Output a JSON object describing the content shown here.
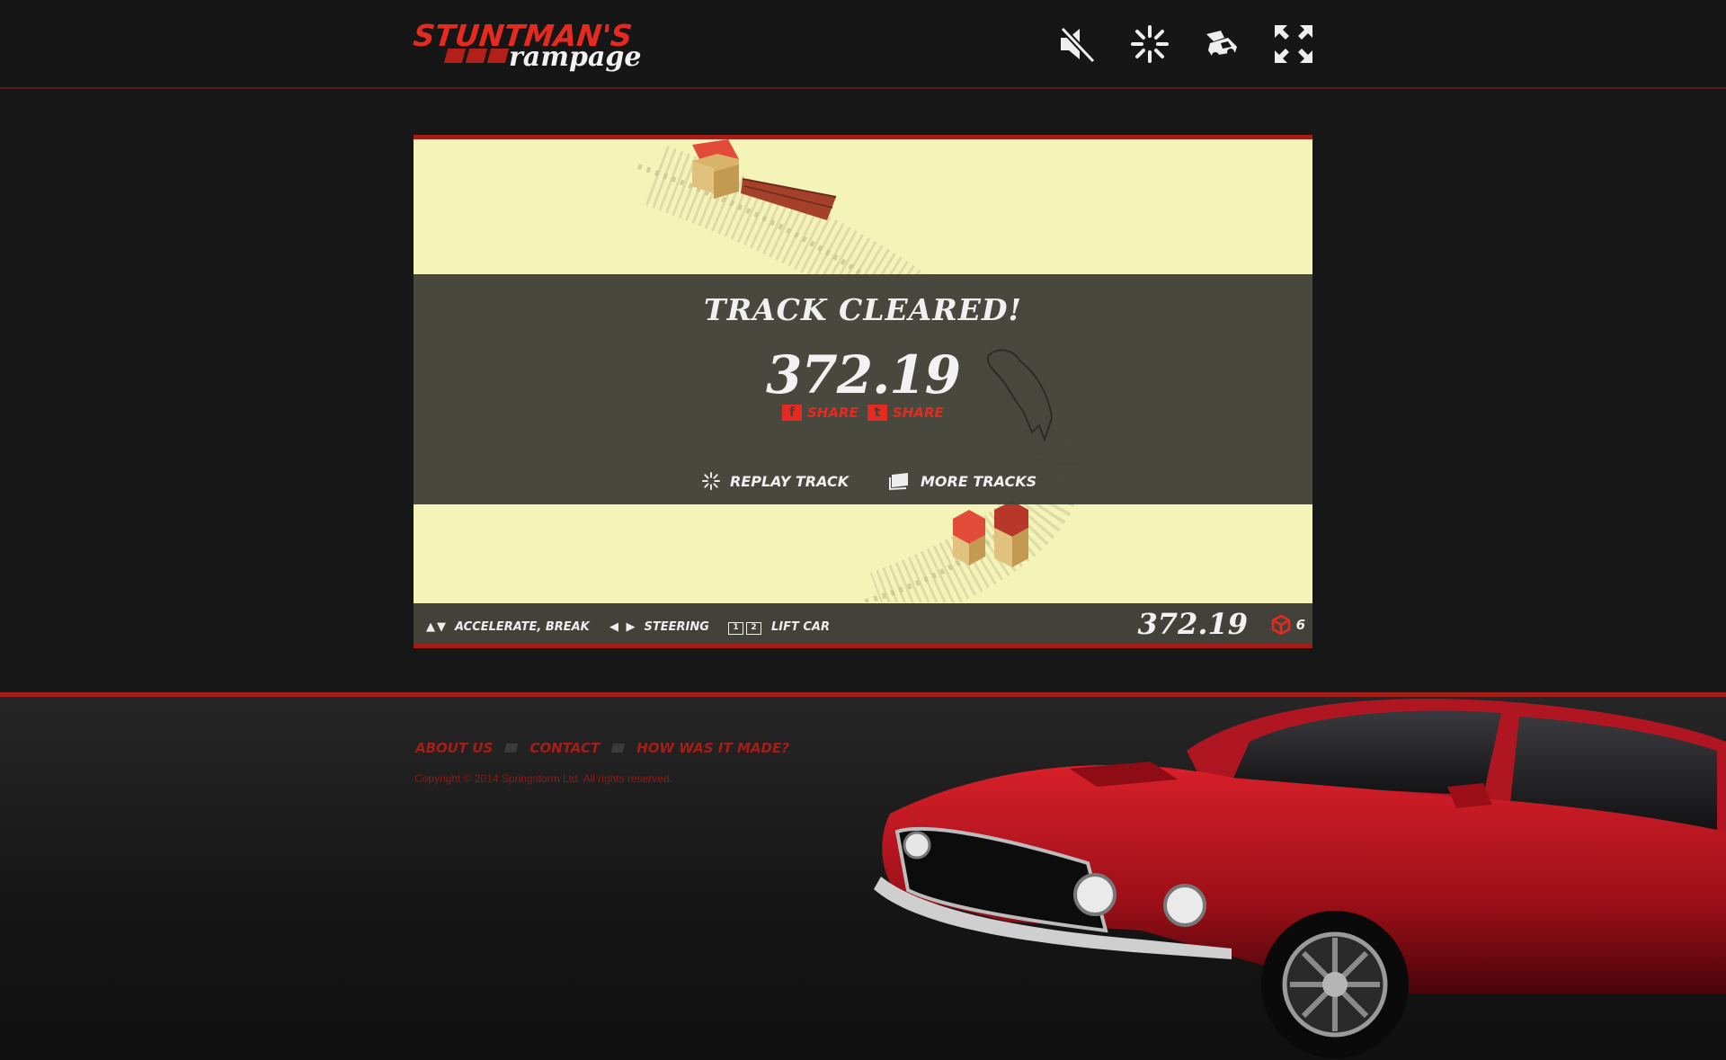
{
  "brand": {
    "line1": "STUNTMAN'S",
    "line2": "rampage",
    "accent": "#e52a1f"
  },
  "header_icons": [
    "mute-icon",
    "restart-icon",
    "lift-car-icon",
    "fullscreen-icon"
  ],
  "overlay": {
    "title": "TRACK CLEARED!",
    "score": "372.19",
    "share_facebook": "SHARE",
    "share_twitter": "SHARE",
    "replay_label": "REPLAY TRACK",
    "more_label": "MORE TRACKS"
  },
  "hud": {
    "accelerate_label": "ACCELERATE, BREAK",
    "steering_label": "STEERING",
    "key1": "1",
    "key2": "2",
    "lift_label": "LIFT CAR",
    "score": "372.19",
    "boxes": "6"
  },
  "footer": {
    "links": [
      "ABOUT US",
      "CONTACT",
      "HOW WAS IT MADE?"
    ],
    "copyright": "Copyright © 2014 Springstorm Ltd. All rights reserved."
  },
  "colors": {
    "red": "#a51d17",
    "sand": "#f4f4b8",
    "panel": "#42423a",
    "bg": "#171717"
  }
}
